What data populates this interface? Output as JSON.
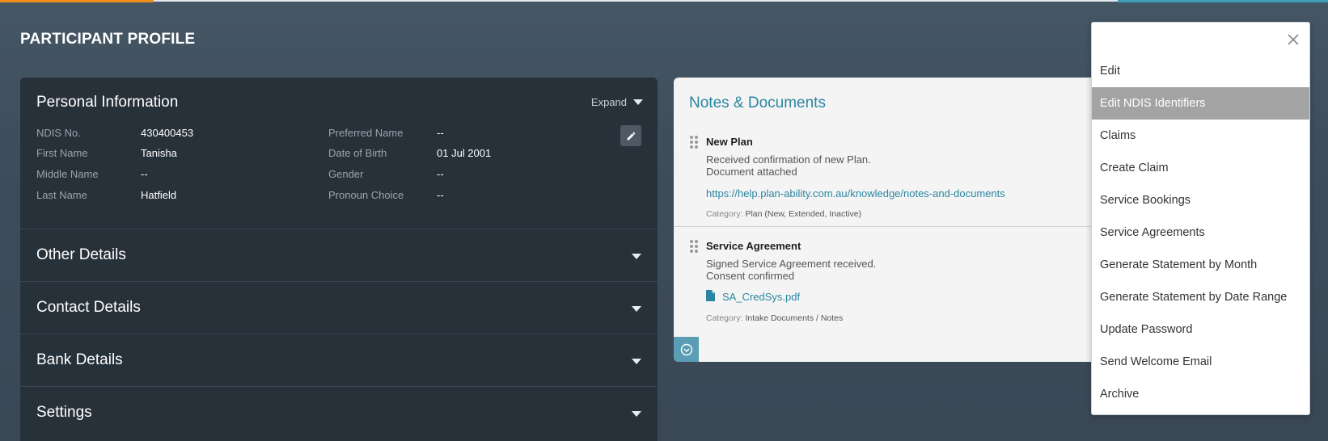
{
  "page": {
    "title": "PARTICIPANT PROFILE"
  },
  "personal_info": {
    "title": "Personal Information",
    "expand_label": "Expand",
    "fields_left": [
      {
        "label": "NDIS No.",
        "value": "430400453"
      },
      {
        "label": "First Name",
        "value": "Tanisha"
      },
      {
        "label": "Middle Name",
        "value": "--"
      },
      {
        "label": "Last Name",
        "value": "Hatfield"
      }
    ],
    "fields_right": [
      {
        "label": "Preferred Name",
        "value": "--"
      },
      {
        "label": "Date of Birth",
        "value": "01 Jul 2001"
      },
      {
        "label": "Gender",
        "value": "--"
      },
      {
        "label": "Pronoun Choice",
        "value": "--"
      }
    ]
  },
  "sections": [
    {
      "title": "Other Details"
    },
    {
      "title": "Contact Details"
    },
    {
      "title": "Bank Details"
    },
    {
      "title": "Settings"
    }
  ],
  "notes": {
    "title": "Notes & Documents",
    "category_label": "Category:",
    "items": [
      {
        "title": "New Plan",
        "line1": "Received confirmation of new Plan.",
        "line2": "Document attached",
        "link": "https://help.plan-ability.com.au/knowledge/notes-and-documents",
        "category": "Plan (New, Extended, Inactive)"
      },
      {
        "title": "Service Agreement",
        "line1": "Signed Service Agreement received.",
        "line2": "Consent confirmed",
        "link": "SA_CredSys.pdf",
        "category": "Intake Documents / Notes"
      }
    ]
  },
  "menu": {
    "items": [
      {
        "label": "Edit"
      },
      {
        "label": "Edit NDIS Identifiers"
      },
      {
        "label": "Claims"
      },
      {
        "label": "Create Claim"
      },
      {
        "label": "Service Bookings"
      },
      {
        "label": "Service Agreements"
      },
      {
        "label": "Generate Statement by Month"
      },
      {
        "label": "Generate Statement by Date Range"
      },
      {
        "label": "Update Password"
      },
      {
        "label": "Send Welcome Email"
      },
      {
        "label": "Archive"
      }
    ],
    "active_index": 1
  },
  "colors": {
    "accent": "#2a86a0",
    "progress": "#f0901f",
    "panel_dark": "#27313a",
    "active_menu": "#a3a3a3"
  }
}
